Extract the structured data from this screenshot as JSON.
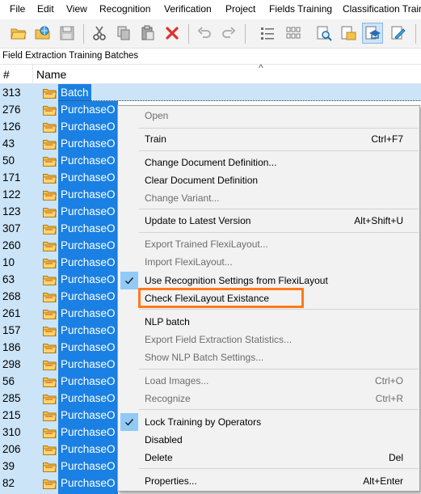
{
  "menubar": {
    "items": [
      "File",
      "Edit",
      "View",
      "Recognition",
      "Verification",
      "Project",
      "Fields Training",
      "Classification Train"
    ]
  },
  "toolbar": {
    "buttons": [
      "open-folder-icon",
      "open-web-folder-icon",
      "save-icon",
      "cut-icon",
      "copy-icon",
      "paste-icon",
      "delete-icon",
      "undo-icon",
      "redo-icon",
      "list-view-icon",
      "thumbnail-view-icon",
      "preview-document-icon",
      "document-settings-icon",
      "training-batch-icon",
      "edit-document-icon"
    ],
    "selected_button": "training-batch-icon"
  },
  "panel": {
    "title": "Field Extraction Training Batches"
  },
  "table": {
    "columns": [
      "#",
      "Name"
    ],
    "rows": [
      {
        "num": "313",
        "name": "Batch"
      },
      {
        "num": "276",
        "name": "PurchaseO"
      },
      {
        "num": "126",
        "name": "PurchaseO"
      },
      {
        "num": "43",
        "name": "PurchaseO"
      },
      {
        "num": "50",
        "name": "PurchaseO"
      },
      {
        "num": "171",
        "name": "PurchaseO"
      },
      {
        "num": "122",
        "name": "PurchaseO"
      },
      {
        "num": "123",
        "name": "PurchaseO"
      },
      {
        "num": "307",
        "name": "PurchaseO"
      },
      {
        "num": "260",
        "name": "PurchaseO"
      },
      {
        "num": "10",
        "name": "PurchaseO"
      },
      {
        "num": "63",
        "name": "PurchaseO"
      },
      {
        "num": "268",
        "name": "PurchaseO"
      },
      {
        "num": "261",
        "name": "PurchaseO"
      },
      {
        "num": "157",
        "name": "PurchaseO"
      },
      {
        "num": "186",
        "name": "PurchaseO"
      },
      {
        "num": "298",
        "name": "PurchaseO"
      },
      {
        "num": "56",
        "name": "PurchaseO"
      },
      {
        "num": "285",
        "name": "PurchaseO"
      },
      {
        "num": "215",
        "name": "PurchaseO"
      },
      {
        "num": "310",
        "name": "PurchaseO"
      },
      {
        "num": "206",
        "name": "PurchaseO"
      },
      {
        "num": "39",
        "name": "PurchaseO"
      },
      {
        "num": "82",
        "name": "PurchaseO"
      }
    ]
  },
  "context_menu": {
    "items": [
      {
        "label": "Open",
        "shortcut": "",
        "disabled": true,
        "checked": false
      },
      {
        "label": "Train",
        "shortcut": "Ctrl+F7",
        "disabled": false,
        "checked": false
      },
      {
        "label": "Change Document Definition...",
        "shortcut": "",
        "disabled": false,
        "checked": false
      },
      {
        "label": "Clear Document Definition",
        "shortcut": "",
        "disabled": false,
        "checked": false
      },
      {
        "label": "Change Variant...",
        "shortcut": "",
        "disabled": true,
        "checked": false
      },
      {
        "label": "Update to Latest Version",
        "shortcut": "Alt+Shift+U",
        "disabled": false,
        "checked": false
      },
      {
        "label": "Export Trained FlexiLayout...",
        "shortcut": "",
        "disabled": true,
        "checked": false
      },
      {
        "label": "Import FlexiLayout...",
        "shortcut": "",
        "disabled": true,
        "checked": false
      },
      {
        "label": "Use Recognition Settings from FlexiLayout",
        "shortcut": "",
        "disabled": false,
        "checked": true
      },
      {
        "label": "Check FlexiLayout Existance",
        "shortcut": "",
        "disabled": false,
        "checked": false
      },
      {
        "label": "NLP batch",
        "shortcut": "",
        "disabled": false,
        "checked": false
      },
      {
        "label": "Export Field Extraction Statistics...",
        "shortcut": "",
        "disabled": true,
        "checked": false
      },
      {
        "label": "Show NLP Batch Settings...",
        "shortcut": "",
        "disabled": true,
        "checked": false
      },
      {
        "label": "Load Images...",
        "shortcut": "Ctrl+O",
        "disabled": true,
        "checked": false
      },
      {
        "label": "Recognize",
        "shortcut": "Ctrl+R",
        "disabled": true,
        "checked": false
      },
      {
        "label": "Lock Training by Operators",
        "shortcut": "",
        "disabled": false,
        "checked": true
      },
      {
        "label": "Disabled",
        "shortcut": "",
        "disabled": false,
        "checked": false
      },
      {
        "label": "Delete",
        "shortcut": "Del",
        "disabled": false,
        "checked": false
      },
      {
        "label": "Properties...",
        "shortcut": "Alt+Enter",
        "disabled": false,
        "checked": false
      }
    ],
    "highlighted_item": "Check FlexiLayout Existance",
    "highlight_color": "#ff7a1a"
  },
  "colors": {
    "selection": "#1a80e3",
    "selection_light": "#cce4f7",
    "menu_bg": "#f2f2f2",
    "check_bg": "#91c9f7"
  }
}
